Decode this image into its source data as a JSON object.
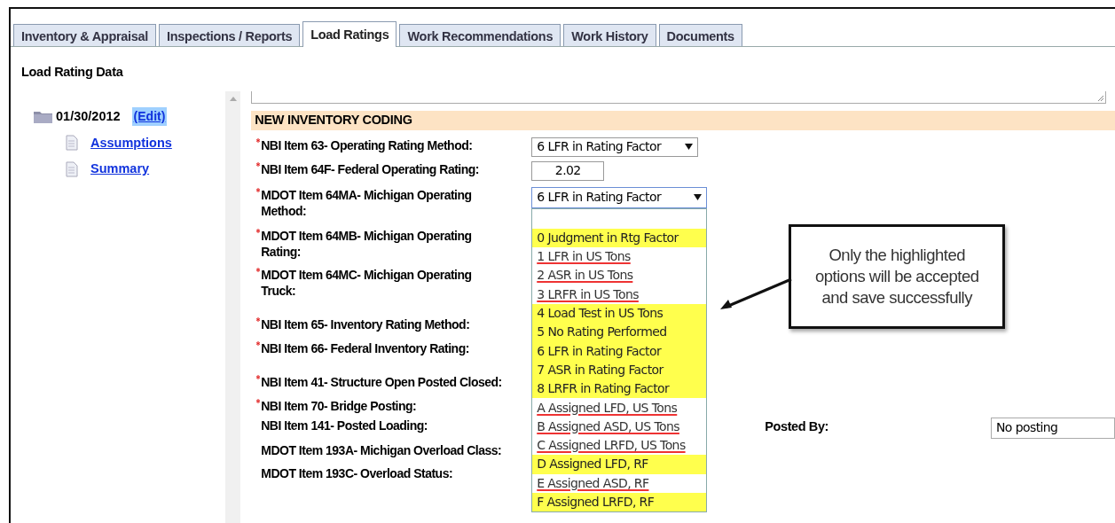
{
  "tabs": [
    {
      "label": "Inventory & Appraisal",
      "selected": false
    },
    {
      "label": "Inspections / Reports",
      "selected": false
    },
    {
      "label": "Load Ratings",
      "selected": true
    },
    {
      "label": "Work Recommendations",
      "selected": false
    },
    {
      "label": "Work History",
      "selected": false
    },
    {
      "label": "Documents",
      "selected": false
    }
  ],
  "page_title": "Load Rating Data",
  "tree": {
    "date": "01/30/2012",
    "edit_link": "(Edit)",
    "children": [
      {
        "label": "Assumptions"
      },
      {
        "label": "Summary"
      }
    ]
  },
  "section_title": "NEW INVENTORY CODING",
  "fields": [
    {
      "label": "NBI Item 63- Operating Rating Method:",
      "required": true,
      "kind": "select",
      "value": "6 LFR in Rating Factor"
    },
    {
      "label": "NBI Item 64F- Federal Operating Rating:",
      "required": true,
      "kind": "text",
      "value": "2.02"
    },
    {
      "label": "MDOT Item 64MA- Michigan Operating Method:",
      "required": true,
      "kind": "open-select",
      "value": "6 LFR in Rating Factor"
    },
    {
      "label": "MDOT Item 64MB- Michigan Operating Rating:",
      "required": true,
      "kind": "none"
    },
    {
      "label": "MDOT Item 64MC- Michigan Operating Truck:",
      "required": true,
      "kind": "none"
    },
    {
      "label": "NBI Item 65- Inventory Rating Method:",
      "required": true,
      "kind": "none"
    },
    {
      "label": "NBI Item 66- Federal Inventory Rating:",
      "required": true,
      "kind": "none"
    },
    {
      "label": "NBI Item 41- Structure Open Posted Closed:",
      "required": true,
      "kind": "none"
    },
    {
      "label": "NBI Item 70- Bridge Posting:",
      "required": true,
      "kind": "none"
    },
    {
      "label": "NBI Item 141- Posted Loading:",
      "required": false,
      "kind": "posted",
      "side_label": "Posted By:",
      "side_value": "No posting"
    },
    {
      "label": "MDOT Item 193A- Michigan Overload Class:",
      "required": false,
      "kind": "none"
    },
    {
      "label": "MDOT Item 193C- Overload Status:",
      "required": false,
      "kind": "none"
    }
  ],
  "options": [
    {
      "label": "0 Judgment in Rtg Factor",
      "accepted": true
    },
    {
      "label": "1 LFR in US Tons",
      "accepted": false
    },
    {
      "label": "2 ASR in US Tons",
      "accepted": false
    },
    {
      "label": "3 LRFR in US Tons",
      "accepted": false
    },
    {
      "label": "4 Load Test in US Tons",
      "accepted": true
    },
    {
      "label": "5 No Rating Performed",
      "accepted": true
    },
    {
      "label": "6 LFR in Rating Factor",
      "accepted": true
    },
    {
      "label": "7 ASR in Rating Factor",
      "accepted": true
    },
    {
      "label": "8 LRFR in Rating Factor",
      "accepted": true
    },
    {
      "label": "A Assigned LFD, US Tons",
      "accepted": false
    },
    {
      "label": "B Assigned ASD, US Tons",
      "accepted": false
    },
    {
      "label": "C Assigned LRFD, US Tons",
      "accepted": false
    },
    {
      "label": "D Assigned LFD, RF",
      "accepted": true
    },
    {
      "label": "E Assigned ASD, RF",
      "accepted": false
    },
    {
      "label": "F Assigned LRFD, RF",
      "accepted": true
    }
  ],
  "callout": "Only the highlighted options will be accepted and save successfully"
}
